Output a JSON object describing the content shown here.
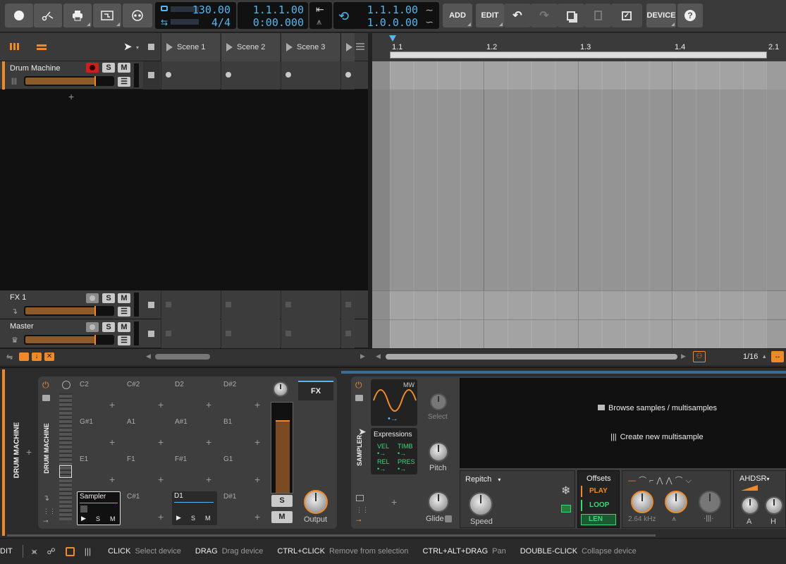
{
  "toolbar": {
    "tempo": "130.00",
    "time_sig": "4/4",
    "position_bars": "1.1.1.00",
    "position_time": "0:00.000",
    "loop_start": "1.1.1.00",
    "loop_length": "1.0.0.00",
    "add_label": "ADD",
    "edit_label": "EDIT",
    "device_label": "DEVICE"
  },
  "scenes": [
    "Scene 1",
    "Scene 2",
    "Scene 3"
  ],
  "tracks": [
    {
      "name": "Drum Machine",
      "solo": "S",
      "mute": "M"
    },
    {
      "name": "FX 1",
      "solo": "S",
      "mute": "M"
    },
    {
      "name": "Master",
      "solo": "S",
      "mute": "M"
    }
  ],
  "ruler": [
    "1.1",
    "1.2",
    "1.3",
    "1.4",
    "2.1"
  ],
  "grid_value": "1/16",
  "device": {
    "chain_label": "DRUM MACHINE",
    "drum_label": "DRUM MACHINE",
    "pads": [
      "C2",
      "C#2",
      "D2",
      "D#2",
      "G#1",
      "A1",
      "A#1",
      "B1",
      "E1",
      "F1",
      "F#1",
      "G1",
      "C#1",
      "D#1"
    ],
    "pad_sampler": "Sampler",
    "pad_d1": "D1",
    "pad_s": "S",
    "pad_m": "M",
    "fx_label": "FX",
    "output_label": "Output",
    "s_label": "S",
    "m_label": "M",
    "sampler_label": "SAMPLER",
    "mw_label": "MW",
    "select_label": "Select",
    "pitch_label": "Pitch",
    "glide_label": "Glide",
    "expressions_label": "Expressions",
    "vel": "VEL",
    "timb": "TIMB",
    "rel": "REL",
    "pres": "PRES",
    "browse_label": "Browse samples / multisamples",
    "create_label": "Create new multisample",
    "repitch_label": "Repitch",
    "speed_label": "Speed",
    "offsets_label": "Offsets",
    "play_label": "PLAY",
    "loop_label": "LOOP",
    "len_label": "LEN",
    "freq_label": "2.64 kHz",
    "ahdsr_label": "AHDSR",
    "a_label": "A",
    "h_label": "H"
  },
  "status": [
    {
      "key": "CLICK",
      "desc": "Select device"
    },
    {
      "key": "DRAG",
      "desc": "Drag device"
    },
    {
      "key": "CTRL+CLICK",
      "desc": "Remove from selection"
    },
    {
      "key": "CTRL+ALT+DRAG",
      "desc": "Pan"
    },
    {
      "key": "DOUBLE-CLICK",
      "desc": "Collapse device"
    }
  ],
  "status_left": "DIT",
  "colors": {
    "accent": "#f08a28",
    "blue": "#53b6f0",
    "green": "#3dd67a"
  }
}
